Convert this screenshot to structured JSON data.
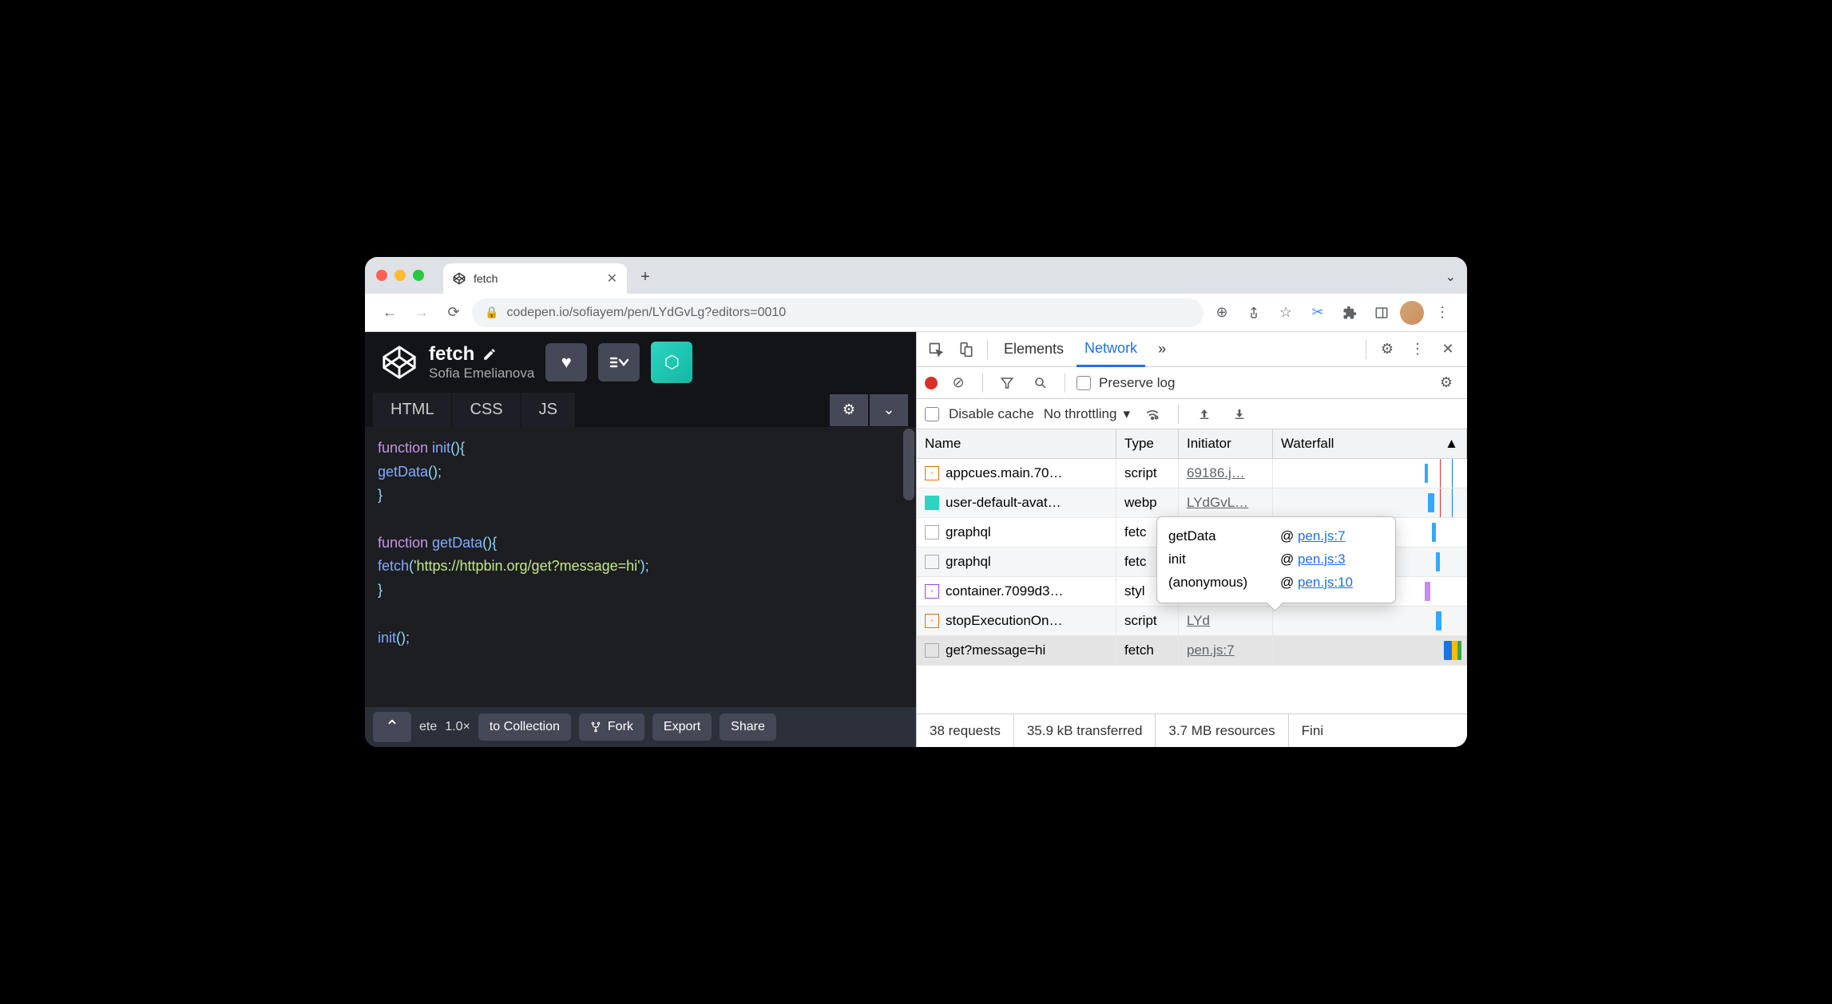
{
  "browser": {
    "tab_title": "fetch",
    "url": "codepen.io/sofiayem/pen/LYdGvLg?editors=0010",
    "colors": {
      "traffic": [
        "#ff5f57",
        "#febc2e",
        "#28c840"
      ]
    }
  },
  "codepen": {
    "title": "fetch",
    "author": "Sofia Emelianova",
    "tabs": [
      "HTML",
      "CSS",
      "JS"
    ],
    "code_lines": [
      [
        {
          "t": "function ",
          "c": "kw"
        },
        {
          "t": "init",
          "c": "fn"
        },
        {
          "t": "(){",
          "c": "pn"
        }
      ],
      [
        {
          "t": "  getData",
          "c": "fn"
        },
        {
          "t": "();",
          "c": "pn"
        }
      ],
      [
        {
          "t": "}",
          "c": "pn"
        }
      ],
      [],
      [
        {
          "t": "function ",
          "c": "kw"
        },
        {
          "t": "getData",
          "c": "fn"
        },
        {
          "t": "(){",
          "c": "pn"
        }
      ],
      [
        {
          "t": "  fetch",
          "c": "fn"
        },
        {
          "t": "(",
          "c": "pn"
        },
        {
          "t": "'https://httpbin.org/get?message=hi'",
          "c": "str"
        },
        {
          "t": ");",
          "c": "pn"
        }
      ],
      [
        {
          "t": "}",
          "c": "pn"
        }
      ],
      [],
      [
        {
          "t": "init",
          "c": "fn"
        },
        {
          "t": "();",
          "c": "pn"
        }
      ]
    ],
    "footer_frag_1": "ete",
    "footer_zoom": "1.0×",
    "footer_collection": "to Collection",
    "footer_fork": "Fork",
    "footer_export": "Export",
    "footer_share": "Share"
  },
  "devtools": {
    "panels": {
      "elements": "Elements",
      "network": "Network",
      "more": "»"
    },
    "preserve_log": "Preserve log",
    "disable_cache": "Disable cache",
    "throttling": "No throttling",
    "columns": {
      "name": "Name",
      "type": "Type",
      "initiator": "Initiator",
      "waterfall": "Waterfall"
    },
    "rows": [
      {
        "icon": "#e8710a",
        "name": "appcues.main.70…",
        "type": "script",
        "initiator": "69186.j…"
      },
      {
        "icon": "teal",
        "name": "user-default-avat…",
        "type": "webp",
        "initiator": "LYdGvL…"
      },
      {
        "icon": "none",
        "name": "graphql",
        "type": "fetc",
        "initiator": ""
      },
      {
        "icon": "none",
        "name": "graphql",
        "type": "fetc",
        "initiator": ""
      },
      {
        "icon": "#a142f4",
        "name": "container.7099d3…",
        "type": "styl",
        "initiator": ""
      },
      {
        "icon": "#e8710a",
        "name": "stopExecutionOn…",
        "type": "script",
        "initiator": "LYd"
      },
      {
        "icon": "none",
        "name": "get?message=hi",
        "type": "fetch",
        "initiator": "pen.js:7",
        "sel": true
      }
    ],
    "tooltip": [
      {
        "fn": "getData",
        "loc": "pen.js:7"
      },
      {
        "fn": "init",
        "loc": "pen.js:3"
      },
      {
        "fn": "(anonymous)",
        "loc": "pen.js:10"
      }
    ],
    "status": {
      "requests": "38 requests",
      "transferred": "35.9 kB transferred",
      "resources": "3.7 MB resources",
      "finish": "Fini"
    }
  }
}
